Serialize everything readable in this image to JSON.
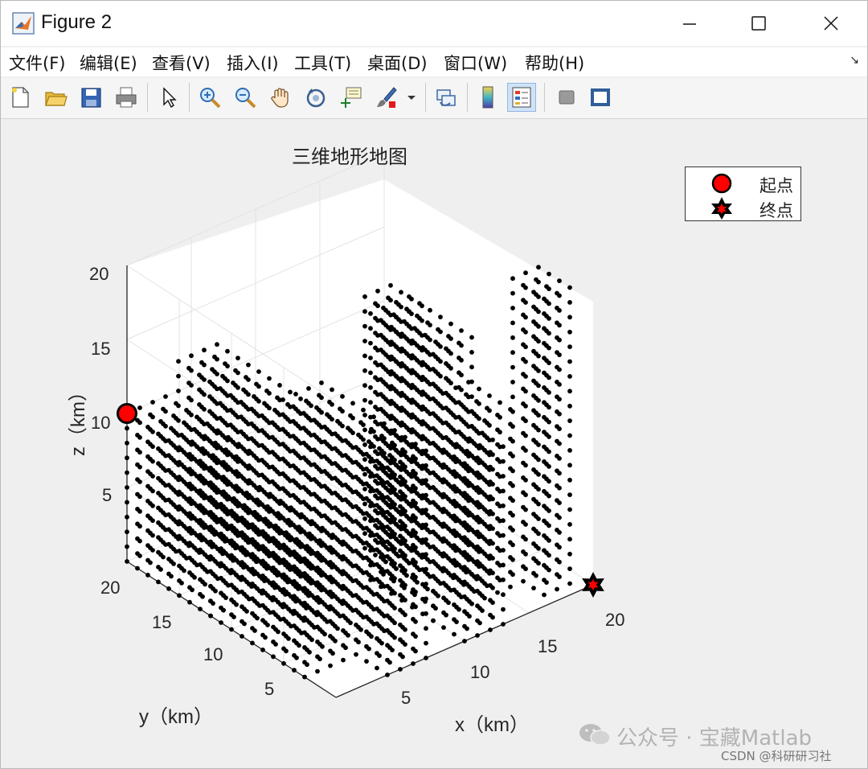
{
  "window": {
    "title": "Figure 2"
  },
  "menu": {
    "items": [
      "文件(F)",
      "编辑(E)",
      "查看(V)",
      "插入(I)",
      "工具(T)",
      "桌面(D)",
      "窗口(W)",
      "帮助(H)"
    ],
    "overflow_arrow": "↘"
  },
  "toolbar": {
    "icons": [
      "new-figure-icon",
      "open-file-icon",
      "save-icon",
      "print-icon",
      "select-arrow-icon",
      "zoom-in-icon",
      "zoom-out-icon",
      "pan-hand-icon",
      "rotate-3d-icon",
      "data-cursor-icon",
      "brush-icon",
      "brush-dropdown-icon",
      "link-plot-icon",
      "colorbar-icon",
      "legend-icon",
      "hide-plot-tools-icon",
      "show-plot-tools-icon"
    ],
    "active": "legend-icon"
  },
  "plot": {
    "title": "三维地形地图",
    "x_label": "x（km）",
    "y_label": "y（km）",
    "z_label": "z（km）",
    "x_ticks": [
      "5",
      "10",
      "15",
      "20"
    ],
    "y_ticks": [
      "5",
      "10",
      "15",
      "20"
    ],
    "z_ticks": [
      "5",
      "10",
      "15",
      "20"
    ],
    "legend": [
      {
        "label": "起点",
        "marker": "filled-circle",
        "color": "#ff0000"
      },
      {
        "label": "终点",
        "marker": "hexagram",
        "color": "#ff0000"
      }
    ]
  },
  "chart_data": {
    "type": "scatter",
    "title": "三维地形地图",
    "xlabel": "x（km）",
    "ylabel": "y（km）",
    "zlabel": "z（km）",
    "xlim": [
      0,
      20
    ],
    "ylim": [
      0,
      20
    ],
    "zlim": [
      0,
      20
    ],
    "grid": true,
    "legend_position": "top-right",
    "series": [
      {
        "name": "起点",
        "points": [
          [
            0,
            20,
            10
          ]
        ],
        "color": "#ff0000"
      },
      {
        "name": "终点",
        "points": [
          [
            20,
            0,
            0
          ]
        ],
        "color": "#ff0000"
      }
    ],
    "obstacles": [
      {
        "x": [
          0,
          3
        ],
        "y": [
          12,
          20
        ],
        "height": 10
      },
      {
        "x": [
          0,
          3
        ],
        "y": [
          3,
          12
        ],
        "height": 8
      },
      {
        "x": [
          4,
          7
        ],
        "y": [
          0,
          10
        ],
        "height": 14
      },
      {
        "x": [
          4,
          7
        ],
        "y": [
          10,
          20
        ],
        "height": 12
      },
      {
        "x": [
          10,
          13
        ],
        "y": [
          0,
          3
        ],
        "height": 12
      },
      {
        "x": [
          10,
          13
        ],
        "y": [
          3,
          9
        ],
        "height": 18
      },
      {
        "x": [
          12,
          14
        ],
        "y": [
          9,
          12
        ],
        "height": 17
      },
      {
        "x": [
          14,
          16
        ],
        "y": [
          3,
          7
        ],
        "height": 12
      },
      {
        "x": [
          17,
          19
        ],
        "y": [
          1,
          4
        ],
        "height": 20
      }
    ],
    "marker_color": "#000000"
  },
  "watermark": {
    "text": "公众号 · 宝藏Matlab",
    "credit": "CSDN @科研研习社"
  }
}
